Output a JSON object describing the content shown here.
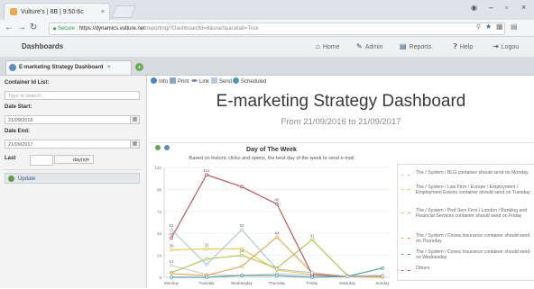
{
  "browser": {
    "tab_title": "Vulture's | 8B | 9:50:6c",
    "tab_close": "×",
    "url_secure": "Secure",
    "url_host": "https://dynamics.vulture.net",
    "url_path": "/reporting/?DashboardId=8&useSpacelab=True",
    "window_minimize": "–",
    "window_maximize": "▫",
    "window_close": "×"
  },
  "app": {
    "brand": "Dashboards",
    "nav": [
      {
        "label": "Home",
        "icon": "home-icon"
      },
      {
        "label": "Admin",
        "icon": "wrench-icon"
      },
      {
        "label": "Reports",
        "icon": "report-icon"
      },
      {
        "label": "Help",
        "icon": "help-icon"
      },
      {
        "label": "Logou",
        "icon": "logout-icon"
      }
    ]
  },
  "dashboard_tab": {
    "label": "E-marketing Strategy Dashboard",
    "close": "×"
  },
  "filters": {
    "container_label": "Container Id List:",
    "container_placeholder": "Type to search...",
    "date_start_label": "Date Start:",
    "date_start_value": "21/09/2016",
    "date_end_label": "Date End:",
    "date_end_value": "21/09/2017",
    "last_label": "Last",
    "last_value": "",
    "last_unit": "day(s)",
    "update_label": "Update"
  },
  "toolbar": {
    "info": "Info",
    "print": "Print",
    "link": "Link",
    "send": "Send",
    "scheduled": "Scheduled"
  },
  "dashboard": {
    "title": "E-marketing Strategy Dashboard",
    "date_range": "From 21/09/2016 to 21/09/2017"
  },
  "colors": {
    "blue_gray": "#a9c0d6",
    "red": "#b04848",
    "olive": "#a7c244",
    "orange": "#e0a04a",
    "gold": "#e8c74a",
    "teal": "#4a9aa0",
    "gray": "#c8c8c8"
  },
  "chart_data": {
    "type": "line",
    "title": "Day of The Week",
    "subtitle": "Based on historic clicks and opens, the best day of the week to send e-mail",
    "categories": [
      "Monday",
      "Tuesday",
      "Wednesday",
      "Thursday",
      "Friday",
      "Saturday",
      "Sunday"
    ],
    "ylim": [
      0,
      120
    ],
    "yticks": [
      0,
      24,
      48,
      72,
      96,
      120
    ],
    "series": [
      {
        "name": "The / System / BLG container should send on Monday",
        "color": "#c8c8c8",
        "values": [
          13,
          3,
          2,
          4,
          2,
          1,
          2
        ]
      },
      {
        "name": "The / System / Law Firm / Europe / Employment / Employment Events container should send on Tuesday",
        "color": "#e8c74a",
        "values": [
          30,
          31,
          31,
          8,
          3,
          1,
          1
        ]
      },
      {
        "name": "The / System / Prof Serv Firm / London / Banking and Financial Services container should send on Friday",
        "color": "#a7c244",
        "values": [
          5,
          20,
          24,
          10,
          41,
          2,
          1
        ]
      },
      {
        "name": "The / System / Covea Insurance container should send on Thursday",
        "color": "#e0a04a",
        "values": [
          4,
          2,
          12,
          44,
          5,
          1,
          0
        ]
      },
      {
        "name": "The / System / Covea Insurance container should send on Wednesday",
        "color": "#4a9aa0",
        "values": [
          0,
          0,
          2,
          2,
          0,
          1,
          10
        ]
      },
      {
        "name": "Others",
        "color": "#b04848",
        "values": [
          43,
          112,
          99,
          80,
          3,
          1,
          2
        ]
      },
      {
        "name": "",
        "color": "#a9c0d6",
        "values": [
          52,
          14,
          52,
          9,
          5,
          1,
          2
        ]
      }
    ],
    "point_labels": [
      {
        "series": 5,
        "index": 1,
        "text": "112"
      },
      {
        "series": 5,
        "index": 3,
        "text": "80"
      },
      {
        "series": 6,
        "index": 0,
        "text": "52"
      },
      {
        "series": 6,
        "index": 2,
        "text": "52"
      },
      {
        "series": 5,
        "index": 0,
        "text": "43"
      },
      {
        "series": 3,
        "index": 3,
        "text": "44"
      },
      {
        "series": 2,
        "index": 4,
        "text": "41"
      },
      {
        "series": 1,
        "index": 1,
        "text": "31"
      },
      {
        "series": 1,
        "index": 0,
        "text": "30"
      },
      {
        "series": 2,
        "index": 2,
        "text": "24"
      },
      {
        "series": 0,
        "index": 0,
        "text": "13"
      }
    ],
    "legend_position": "right"
  }
}
